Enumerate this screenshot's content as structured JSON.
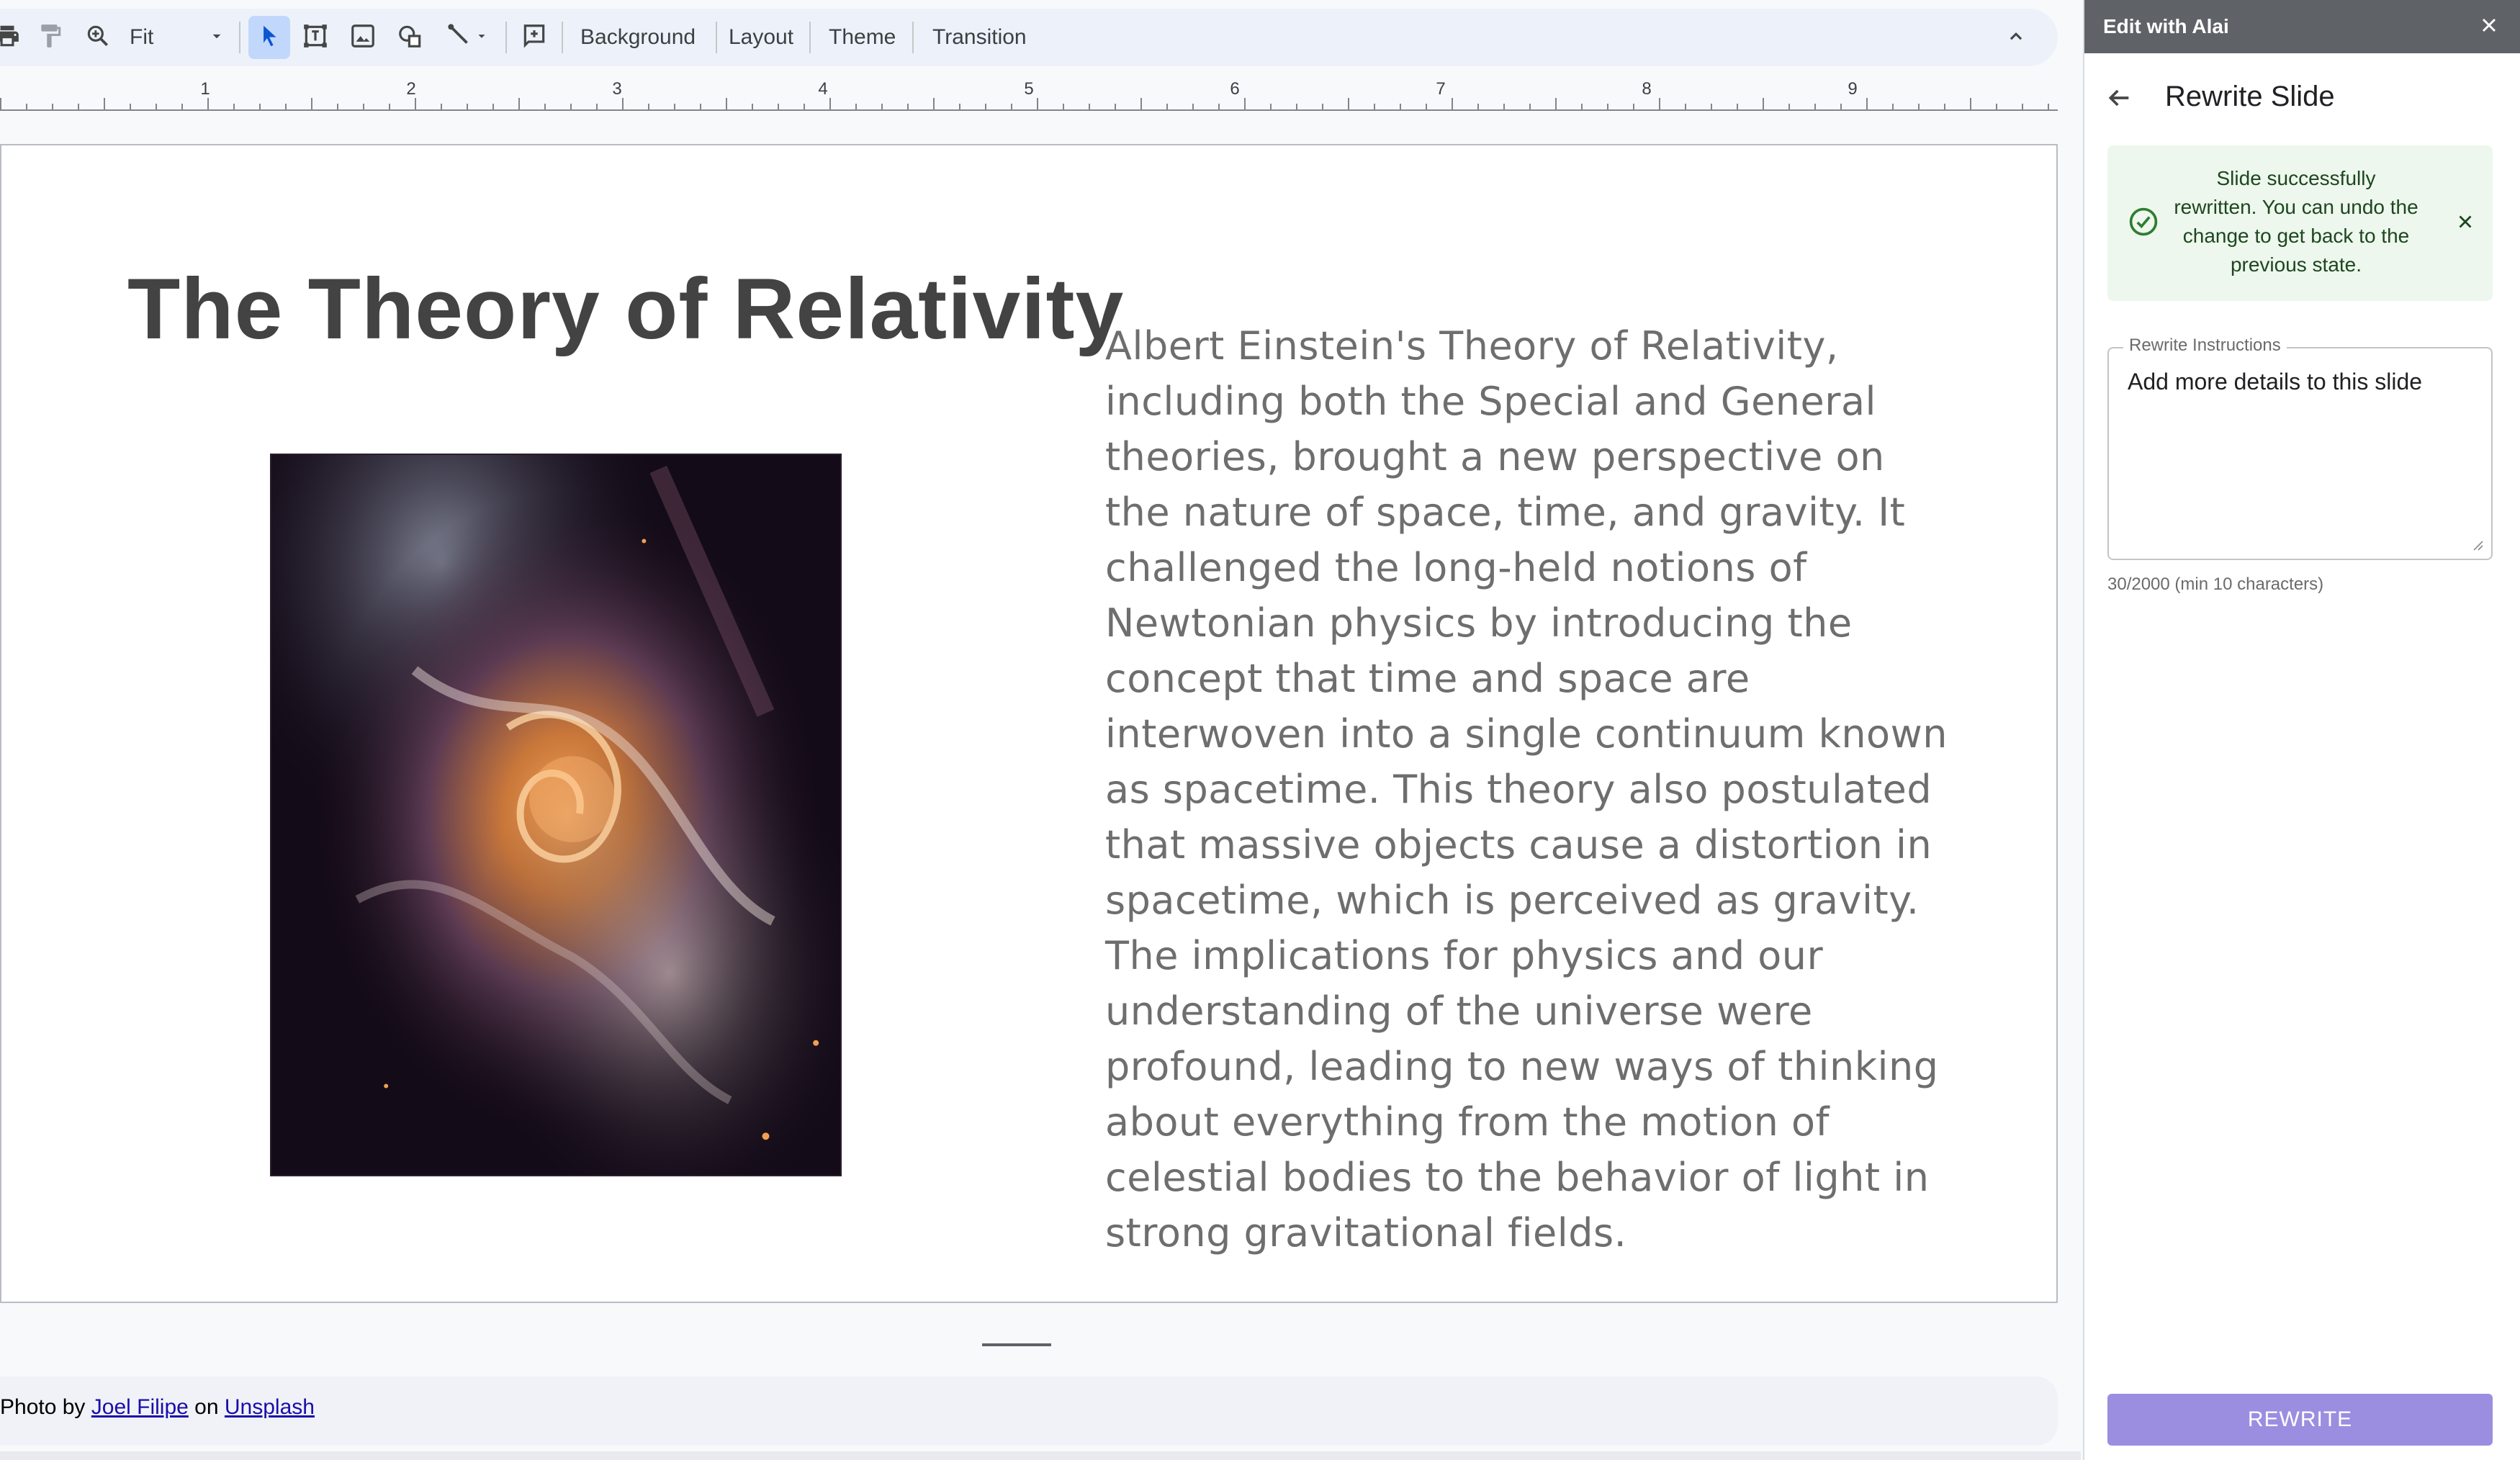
{
  "toolbar": {
    "zoom_value": "Fit",
    "background_label": "Background",
    "layout_label": "Layout",
    "theme_label": "Theme",
    "transition_label": "Transition"
  },
  "ruler": {
    "numbers": [
      "1",
      "2",
      "3",
      "4",
      "5",
      "6",
      "7",
      "8",
      "9"
    ]
  },
  "slide": {
    "title": "The Theory of Relativity",
    "body": "Albert Einstein's Theory of Relativity, including both the Special and General theories, brought a new perspective on the nature of space, time, and gravity. It challenged the long-held notions of Newtonian physics by introducing the concept that time and space are interwoven into a single continuum known as spacetime. This theory also postulated that massive objects cause a distortion in spacetime, which is perceived as gravity. The implications for physics and our understanding of the universe were profound, leading to new ways of thinking about everything from the motion of celestial bodies to the behavior of light in strong gravitational fields."
  },
  "notes": {
    "prefix": "Photo by",
    "author_link": "Joel Filipe",
    "middle": "on",
    "source_link": "Unsplash"
  },
  "panel": {
    "header_title": "Edit with Alai",
    "title": "Rewrite Slide",
    "alert_message": "Slide successfully rewritten. You can undo the change to get back to the previous state.",
    "field_label": "Rewrite Instructions",
    "field_value": "Add more details to this slide",
    "counter": "30/2000 (min 10 characters)",
    "rewrite_button": "REWRITE"
  },
  "colors": {
    "toolbar_bg": "#edf2fa",
    "selected_tool": "#c2d7fc",
    "alert_bg": "#edf7ed",
    "alert_icon": "#2e7d32",
    "button_bg": "#9b8ee0",
    "header_bg": "#5f6368"
  },
  "icons": [
    "print-icon",
    "paint-format-icon",
    "zoom-icon",
    "chevron-down-icon",
    "cursor-icon",
    "text-box-icon",
    "image-icon",
    "shape-icon",
    "line-icon",
    "comment-icon",
    "chevron-up-icon",
    "close-icon",
    "arrow-back-icon",
    "check-circle-icon"
  ]
}
